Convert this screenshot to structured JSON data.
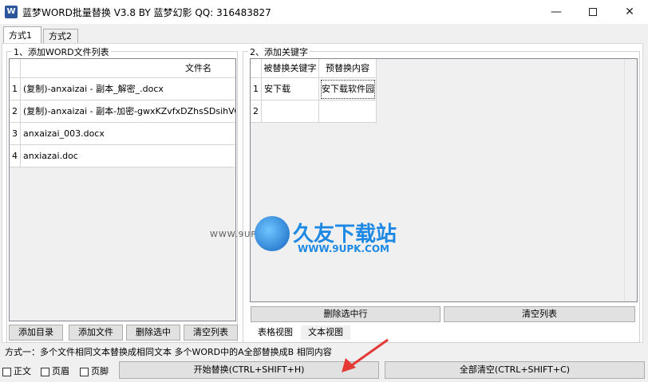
{
  "window": {
    "title": "蓝梦WORD批量替换 V3.8 BY 蓝梦幻影 QQ: 316483827",
    "icon_label": "W",
    "min_glyph": "—",
    "close_glyph": "✕"
  },
  "tabs": [
    {
      "label": "方式1"
    },
    {
      "label": "方式2"
    }
  ],
  "left_group": {
    "title": "1、添加WORD文件列表",
    "column_header": "文件名",
    "rows": [
      {
        "num": "1",
        "name": "(复制)-anxaizai - 副本_解密_.docx"
      },
      {
        "num": "2",
        "name": "(复制)-anxaizai - 副本-加密-gwxKZvfxDZhsSDsihVOI"
      },
      {
        "num": "3",
        "name": "anxaizai_003.docx"
      },
      {
        "num": "4",
        "name": "anxiazai.doc"
      }
    ],
    "buttons": {
      "add_dir": "添加目录",
      "add_file": "添加文件",
      "delete_selected": "删除选中",
      "clear_list": "清空列表"
    }
  },
  "right_group": {
    "title": "2、添加关键字",
    "headers": {
      "find": "被替换关键字",
      "replace": "预替换内容"
    },
    "rows": [
      {
        "num": "1",
        "find": "安下载",
        "replace": "安下载软件园"
      },
      {
        "num": "2",
        "find": "",
        "replace": ""
      }
    ],
    "buttons": {
      "delete_row": "删除选中行",
      "clear_list": "清空列表"
    },
    "view_tabs": {
      "table": "表格视图",
      "text": "文本视图"
    }
  },
  "status": {
    "description": "方式一：多个文件相同文本替换成相同文本  多个WORD中的A全部替换成B 相同内容"
  },
  "bottom": {
    "checkboxes": {
      "body": "正文",
      "header": "页眉",
      "footer": "页脚"
    },
    "start_button": "开始替换(CTRL+SHIFT+H)",
    "clear_all_button": "全部清空(CTRL+SHIFT+C)"
  },
  "watermark": {
    "url": "WWW.9UPK.COM",
    "name": "久友下载站",
    "sub": "WWW.9UPK.COM"
  },
  "colors": {
    "accent": "#2b579a",
    "arrow": "#e53935",
    "watermark": "#1e88e5"
  }
}
